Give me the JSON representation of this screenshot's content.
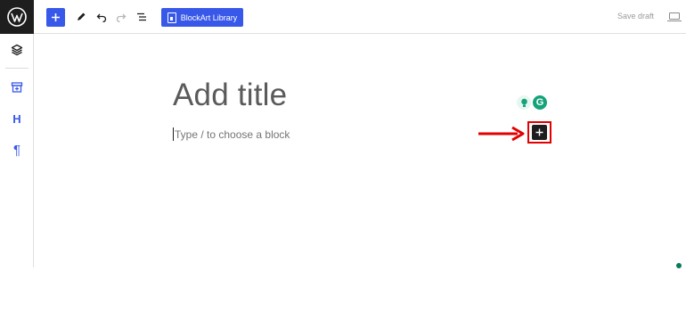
{
  "toolbar": {
    "library_label": "BlockArt Library",
    "save_draft_label": "Save draft"
  },
  "editor": {
    "title_placeholder": "Add title",
    "block_placeholder": "Type / to choose a block"
  },
  "sidebar": {
    "items": [
      {
        "icon": "layers-icon"
      },
      {
        "icon": "archive-icon"
      },
      {
        "icon": "heading-icon",
        "label": "H"
      },
      {
        "icon": "paragraph-icon",
        "label": "¶"
      }
    ]
  },
  "colors": {
    "accent": "#3858e9",
    "highlight": "#e30000",
    "dark": "#1e1e1e",
    "grammarly": "#15a37a"
  }
}
